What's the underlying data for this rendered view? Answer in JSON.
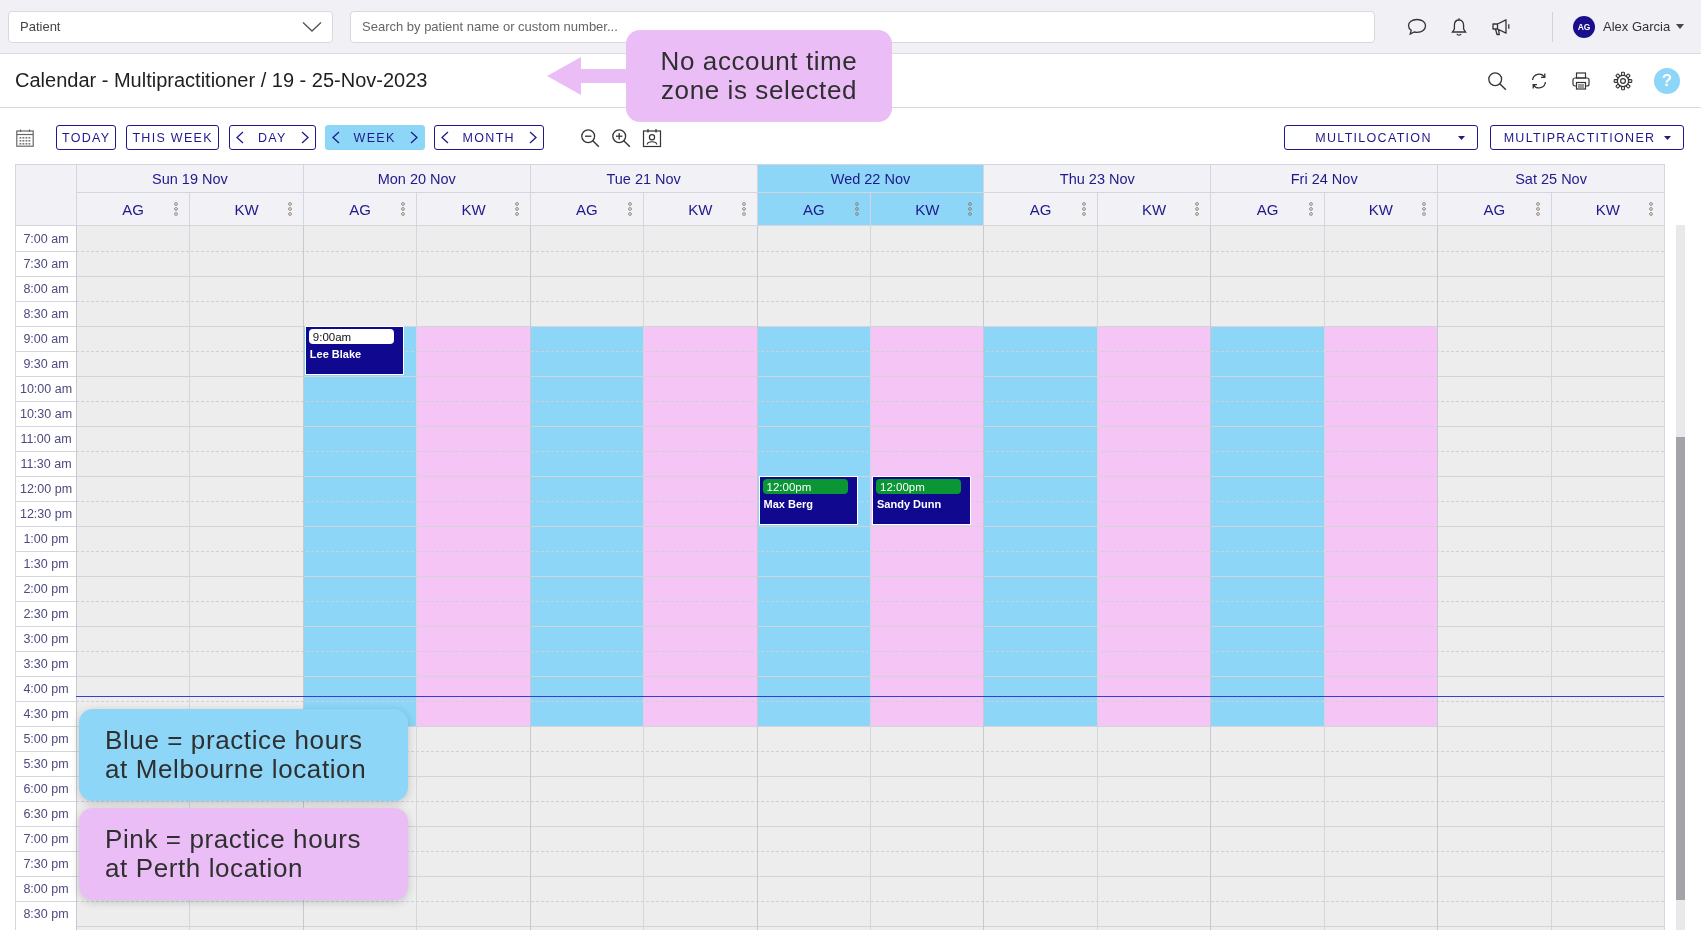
{
  "top_bar": {
    "patient_select": "Patient",
    "search": {
      "placeholder": "Search by patient name or custom number..."
    },
    "user": {
      "initials": "AG",
      "name": "Alex Garcia"
    }
  },
  "header": {
    "title": "Calendar - Multipractitioner / 19 - 25-Nov-2023",
    "help": "?"
  },
  "toolbar": {
    "nav_buttons": [
      "TODAY",
      "THIS WEEK"
    ],
    "view_buttons": [
      {
        "label": "DAY",
        "selected": false
      },
      {
        "label": "WEEK",
        "selected": true
      },
      {
        "label": "MONTH",
        "selected": false
      }
    ],
    "filters": [
      "MULTILOCATION",
      "MULTIPRACTITIONER"
    ]
  },
  "calendar": {
    "days": [
      {
        "label": "Sun 19 Nov",
        "selected": false,
        "columns": [
          {
            "label": "AG"
          },
          {
            "label": "KW"
          }
        ]
      },
      {
        "label": "Mon 20 Nov",
        "selected": false,
        "columns": [
          {
            "label": "AG",
            "color": "#8dd6f7"
          },
          {
            "label": "KW",
            "color": "#f5c6f5"
          }
        ]
      },
      {
        "label": "Tue 21 Nov",
        "selected": false,
        "columns": [
          {
            "label": "AG",
            "color": "#8dd6f7"
          },
          {
            "label": "KW",
            "color": "#f5c6f5"
          }
        ]
      },
      {
        "label": "Wed 22 Nov",
        "selected": true,
        "columns": [
          {
            "label": "AG",
            "color": "#8dd6f7"
          },
          {
            "label": "KW",
            "color": "#f5c6f5"
          }
        ]
      },
      {
        "label": "Thu 23 Nov",
        "selected": false,
        "columns": [
          {
            "label": "AG",
            "color": "#8dd6f7"
          },
          {
            "label": "KW",
            "color": "#f5c6f5"
          }
        ]
      },
      {
        "label": "Fri 24 Nov",
        "selected": false,
        "columns": [
          {
            "label": "AG",
            "color": "#8dd6f7"
          },
          {
            "label": "KW",
            "color": "#f5c6f5"
          }
        ]
      },
      {
        "label": "Sat 25 Nov",
        "selected": false,
        "columns": [
          {
            "label": "AG"
          },
          {
            "label": "KW"
          }
        ]
      }
    ],
    "rows": [
      {
        "label": "7:00 am",
        "kind": "closed",
        "now": false
      },
      {
        "label": "7:30 am",
        "kind": "closed",
        "now": false
      },
      {
        "label": "8:00 am",
        "kind": "closed",
        "now": false
      },
      {
        "label": "8:30 am",
        "kind": "closed",
        "now": false
      },
      {
        "label": "9:00 am",
        "kind": "open",
        "now": false,
        "slots": [
          {
            "kind": "free"
          },
          {
            "kind": "free"
          },
          {
            "kind": "booked",
            "time": "9:00am",
            "name": "Lee Blake",
            "color": "#ffffff"
          },
          {
            "kind": "free"
          },
          {
            "kind": "free"
          },
          {
            "kind": "free"
          },
          {
            "kind": "free"
          },
          {
            "kind": "free"
          },
          {
            "kind": "free"
          },
          {
            "kind": "free"
          },
          {
            "kind": "free"
          },
          {
            "kind": "free"
          },
          {
            "kind": "free"
          },
          {
            "kind": "free"
          }
        ]
      },
      {
        "label": "9:30 am",
        "kind": "open",
        "now": false
      },
      {
        "label": "10:00 am",
        "kind": "open",
        "now": false
      },
      {
        "label": "10:30 am",
        "kind": "open",
        "now": false
      },
      {
        "label": "11:00 am",
        "kind": "open",
        "now": false
      },
      {
        "label": "11:30 am",
        "kind": "open",
        "now": false
      },
      {
        "label": "12:00 pm",
        "kind": "open",
        "now": false,
        "slots": [
          {
            "kind": "free"
          },
          {
            "kind": "free"
          },
          {
            "kind": "free"
          },
          {
            "kind": "free"
          },
          {
            "kind": "free"
          },
          {
            "kind": "free"
          },
          {
            "kind": "booked",
            "time": "12:00pm",
            "name": "Max Berg",
            "color": "#0a9634"
          },
          {
            "kind": "booked",
            "time": "12:00pm",
            "name": "Sandy Dunn",
            "color": "#0a9634"
          },
          {
            "kind": "free"
          },
          {
            "kind": "free"
          },
          {
            "kind": "free"
          },
          {
            "kind": "free"
          },
          {
            "kind": "free"
          },
          {
            "kind": "free"
          }
        ]
      },
      {
        "label": "12:30 pm",
        "kind": "open",
        "now": false
      },
      {
        "label": "1:00 pm",
        "kind": "open",
        "now": false
      },
      {
        "label": "1:30 pm",
        "kind": "open",
        "now": false
      },
      {
        "label": "2:00 pm",
        "kind": "open",
        "now": false
      },
      {
        "label": "2:30 pm",
        "kind": "open",
        "now": false
      },
      {
        "label": "3:00 pm",
        "kind": "open",
        "now": false
      },
      {
        "label": "3:30 pm",
        "kind": "open",
        "now": false
      },
      {
        "label": "4:00 pm",
        "kind": "open",
        "now": true
      },
      {
        "label": "4:30 pm",
        "kind": "open",
        "now": false
      },
      {
        "label": "5:00 pm",
        "kind": "closed",
        "now": false
      },
      {
        "label": "5:30 pm",
        "kind": "closed",
        "now": false
      },
      {
        "label": "6:00 pm",
        "kind": "closed",
        "now": false
      },
      {
        "label": "6:30 pm",
        "kind": "closed",
        "now": false
      },
      {
        "label": "7:00 pm",
        "kind": "closed",
        "now": false
      },
      {
        "label": "7:30 pm",
        "kind": "closed",
        "now": false
      },
      {
        "label": "8:00 pm",
        "kind": "closed",
        "now": false
      },
      {
        "label": "8:30 pm",
        "kind": "closed",
        "now": false
      }
    ]
  },
  "callouts": [
    {
      "kind": "arrow",
      "text": "No account time zone is selected",
      "color": "#ebbdf7"
    },
    {
      "kind": "legend",
      "text": "Blue = practice hours at Melbourne location",
      "color": "#8dd6f7"
    },
    {
      "kind": "legend",
      "text": "Pink = practice hours at Perth location",
      "color": "#ebbdf7"
    }
  ]
}
